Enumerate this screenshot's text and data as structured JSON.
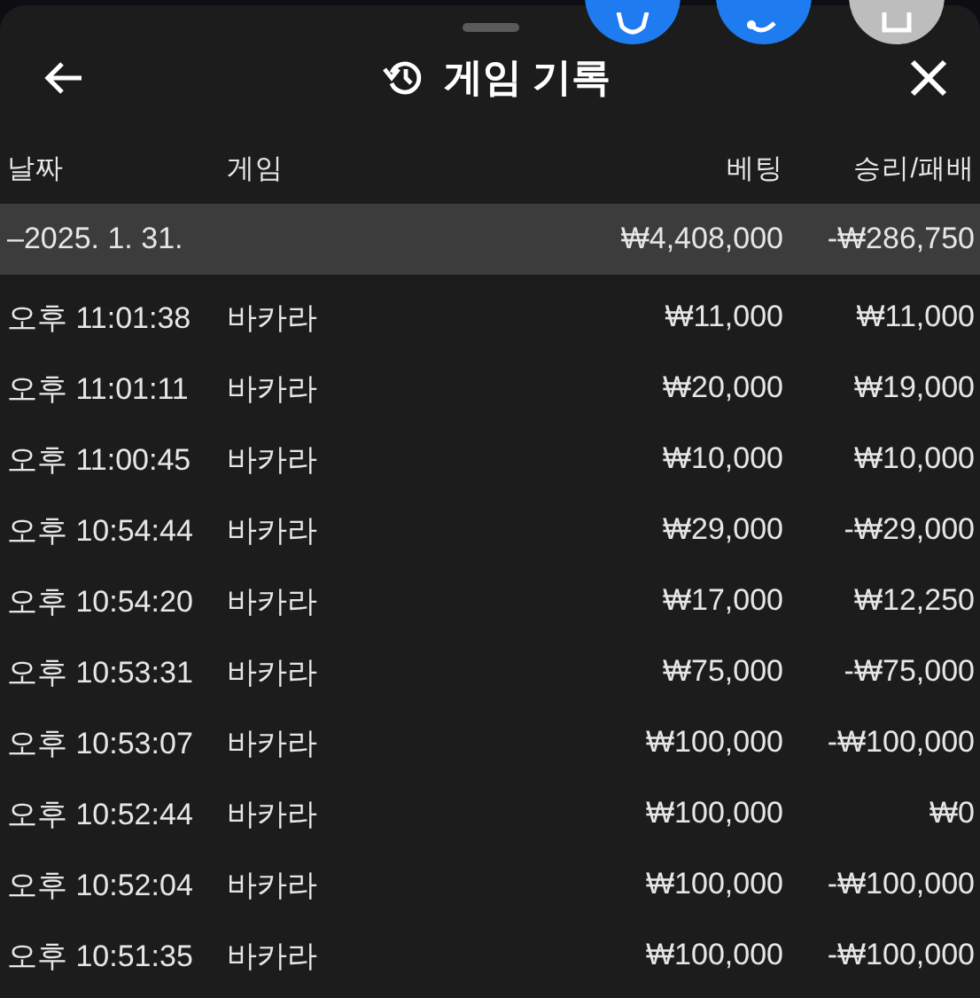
{
  "header": {
    "title": "게임 기록"
  },
  "columns": [
    "날짜",
    "게임",
    "베팅",
    "승리/패배"
  ],
  "summary": {
    "date": "–2025. 1. 31.",
    "bet": "₩4,408,000",
    "result": "-₩286,750"
  },
  "rows": [
    {
      "time": "오후 11:01:38",
      "game": "바카라",
      "bet": "₩11,000",
      "result": "₩11,000"
    },
    {
      "time": "오후 11:01:11",
      "game": "바카라",
      "bet": "₩20,000",
      "result": "₩19,000"
    },
    {
      "time": "오후 11:00:45",
      "game": "바카라",
      "bet": "₩10,000",
      "result": "₩10,000"
    },
    {
      "time": "오후 10:54:44",
      "game": "바카라",
      "bet": "₩29,000",
      "result": "-₩29,000"
    },
    {
      "time": "오후 10:54:20",
      "game": "바카라",
      "bet": "₩17,000",
      "result": "₩12,250"
    },
    {
      "time": "오후 10:53:31",
      "game": "바카라",
      "bet": "₩75,000",
      "result": "-₩75,000"
    },
    {
      "time": "오후 10:53:07",
      "game": "바카라",
      "bet": "₩100,000",
      "result": "-₩100,000"
    },
    {
      "time": "오후 10:52:44",
      "game": "바카라",
      "bet": "₩100,000",
      "result": "₩0"
    },
    {
      "time": "오후 10:52:04",
      "game": "바카라",
      "bet": "₩100,000",
      "result": "-₩100,000"
    },
    {
      "time": "오후 10:51:35",
      "game": "바카라",
      "bet": "₩100,000",
      "result": "-₩100,000"
    }
  ]
}
